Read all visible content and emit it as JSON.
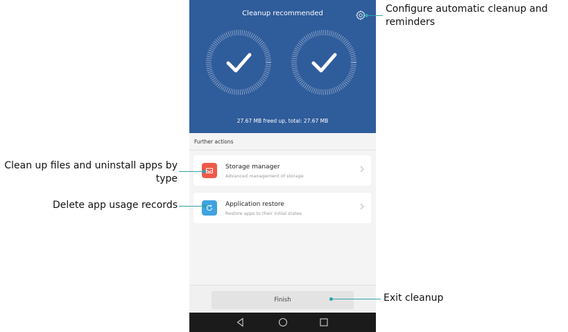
{
  "header": {
    "title": "Cleanup recommended",
    "settings_icon": "gear-icon"
  },
  "summary": {
    "freed_text": "27.67 MB freed up, total: 27.67 MB"
  },
  "section": {
    "title": "Further actions"
  },
  "actions": [
    {
      "title": "Storage manager",
      "subtitle": "Advanced management of storage",
      "icon": "storage-icon",
      "icon_color": "#f05a4a"
    },
    {
      "title": "Application restore",
      "subtitle": "Restore apps to their initial states",
      "icon": "restore-icon",
      "icon_color": "#3fa3e0"
    }
  ],
  "footer": {
    "finish_label": "Finish"
  },
  "callouts": {
    "settings": "Configure automatic cleanup and reminders",
    "storage": "Clean up files and uninstall apps by type",
    "restore": "Delete app usage records",
    "finish": "Exit cleanup"
  },
  "colors": {
    "hero_bg": "#2f5c9b",
    "callout": "#2ba3ad"
  }
}
